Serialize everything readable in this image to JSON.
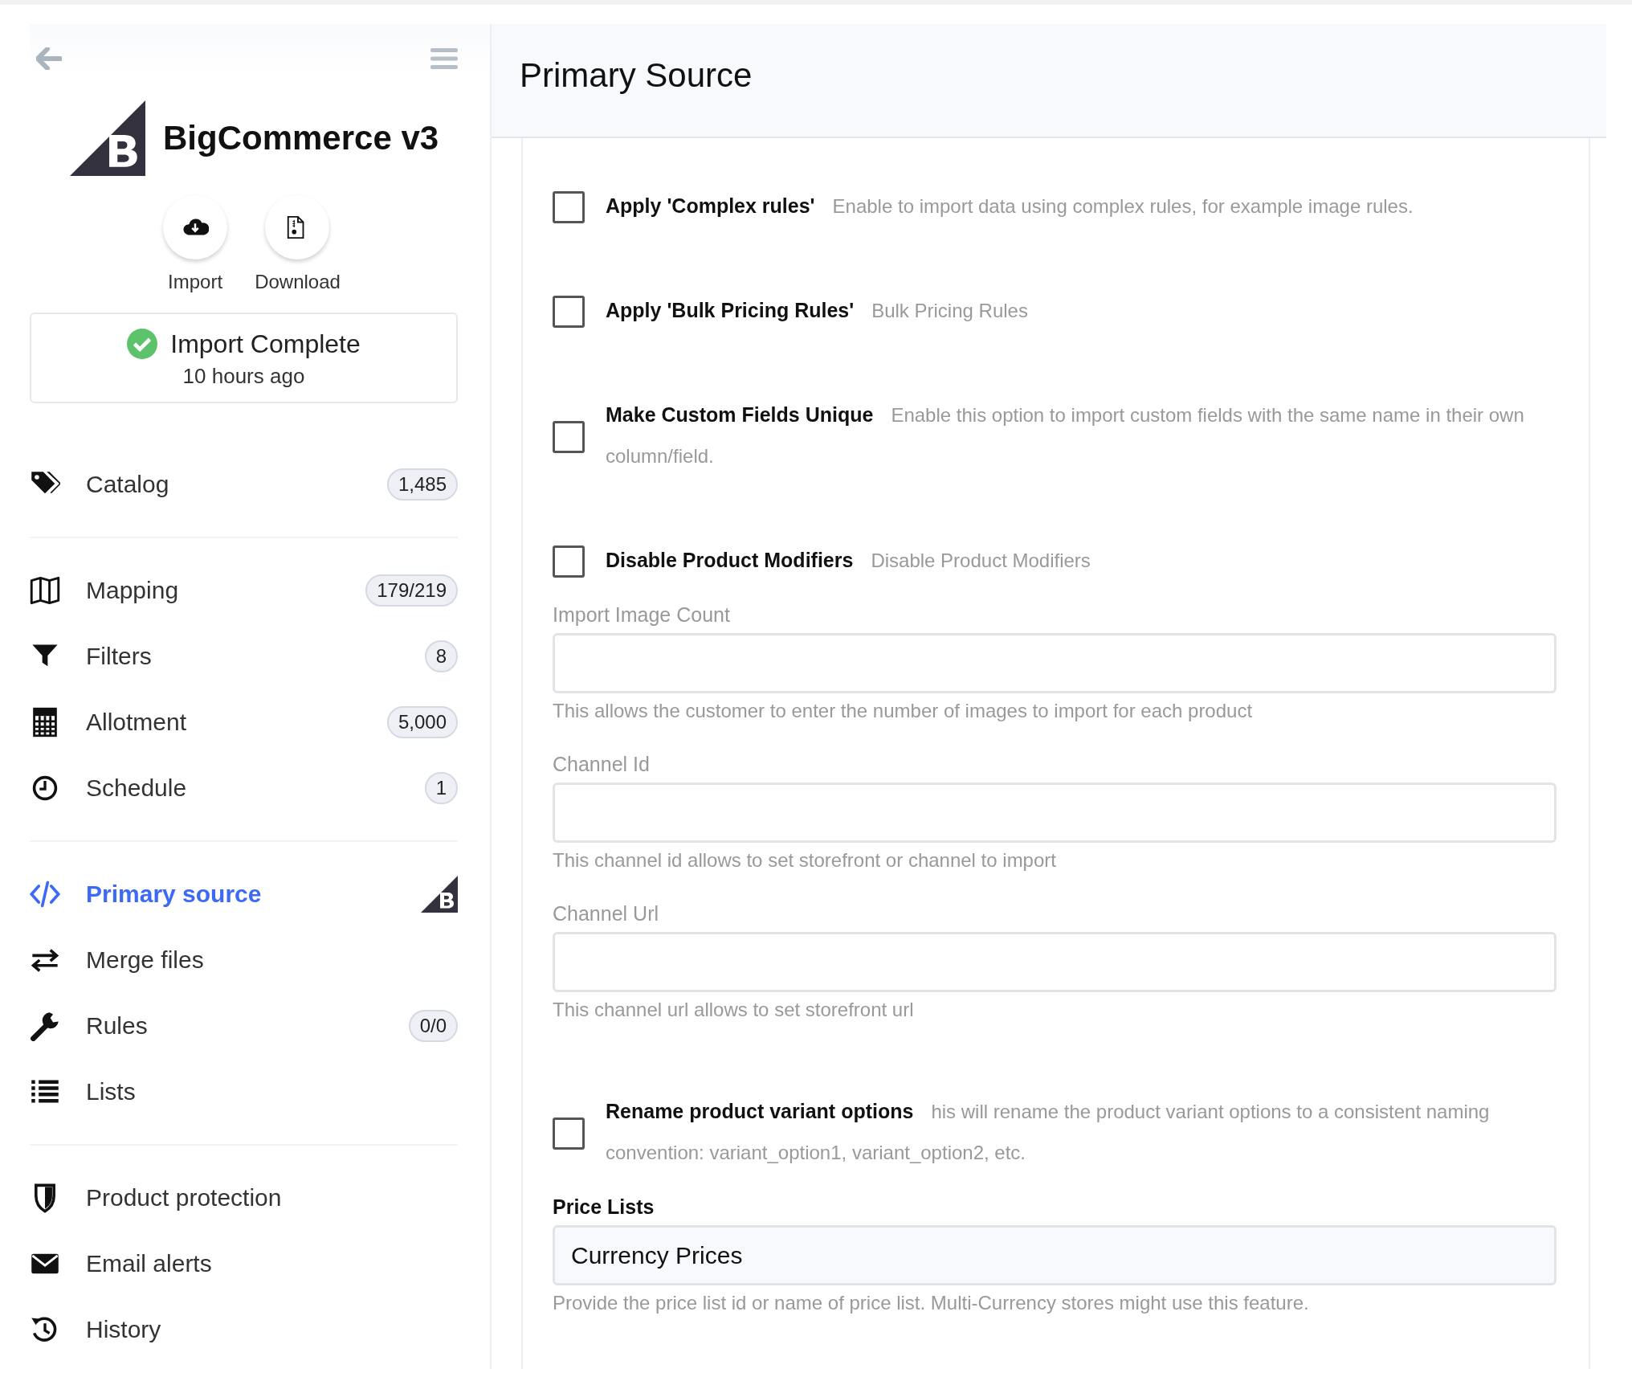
{
  "sidebar": {
    "app_title": "BigCommerce v3",
    "actions": [
      {
        "label": "Import"
      },
      {
        "label": "Download"
      }
    ],
    "status": {
      "title": "Import Complete",
      "time": "10 hours ago"
    },
    "nav_groups": [
      [
        {
          "label": "Catalog",
          "kind": "badge",
          "badge": "1,485",
          "selected": false
        }
      ],
      [
        {
          "label": "Mapping",
          "kind": "badge",
          "badge": "179/219",
          "selected": false
        },
        {
          "label": "Filters",
          "kind": "badge",
          "badge": "8",
          "selected": false
        },
        {
          "label": "Allotment",
          "kind": "badge",
          "badge": "5,000",
          "selected": false
        },
        {
          "label": "Schedule",
          "kind": "badge",
          "badge": "1",
          "selected": false
        }
      ],
      [
        {
          "label": "Primary source",
          "kind": "logo",
          "selected": true
        },
        {
          "label": "Merge files",
          "kind": "plain",
          "selected": false
        },
        {
          "label": "Rules",
          "kind": "badge",
          "badge": "0/0",
          "selected": false
        },
        {
          "label": "Lists",
          "kind": "plain",
          "selected": false
        }
      ],
      [
        {
          "label": "Product protection",
          "kind": "plain",
          "selected": false
        },
        {
          "label": "Email alerts",
          "kind": "plain",
          "selected": false
        },
        {
          "label": "History",
          "kind": "plain",
          "selected": false
        }
      ]
    ]
  },
  "page_title": "Primary Source",
  "fields": [
    {
      "kind": "checkbox",
      "label": "Apply 'Complex rules'",
      "description": "Enable to import data using complex rules, for example image rules.",
      "checked": false
    },
    {
      "kind": "checkbox",
      "label": "Apply 'Bulk Pricing Rules'",
      "description": "Bulk Pricing Rules",
      "checked": false
    },
    {
      "kind": "checkbox",
      "label": "Make Custom Fields Unique",
      "description": "Enable this option to import custom fields with the same name in their own column/field.",
      "checked": false
    },
    {
      "kind": "checkbox",
      "label": "Disable Product Modifiers",
      "description": "Disable Product Modifiers",
      "checked": false
    },
    {
      "kind": "text",
      "label": "Import Image Count",
      "description": "This allows the customer to enter the number of images to import for each product"
    },
    {
      "kind": "text",
      "label": "Channel Id",
      "description": "This channel id allows to set storefront or channel to import"
    },
    {
      "kind": "text",
      "label": "Channel Url",
      "description": "This channel url allows to set storefront url"
    },
    {
      "kind": "checkbox",
      "label": "Rename product variant options",
      "description": "his will rename the product variant options to a consistent naming convention: variant_option1, variant_option2, etc.",
      "checked": false
    },
    {
      "kind": "text",
      "label": "Price Lists",
      "value": "Currency Prices",
      "description": "Provide the price list id or name of price list. Multi-Currency stores might use this feature."
    }
  ]
}
